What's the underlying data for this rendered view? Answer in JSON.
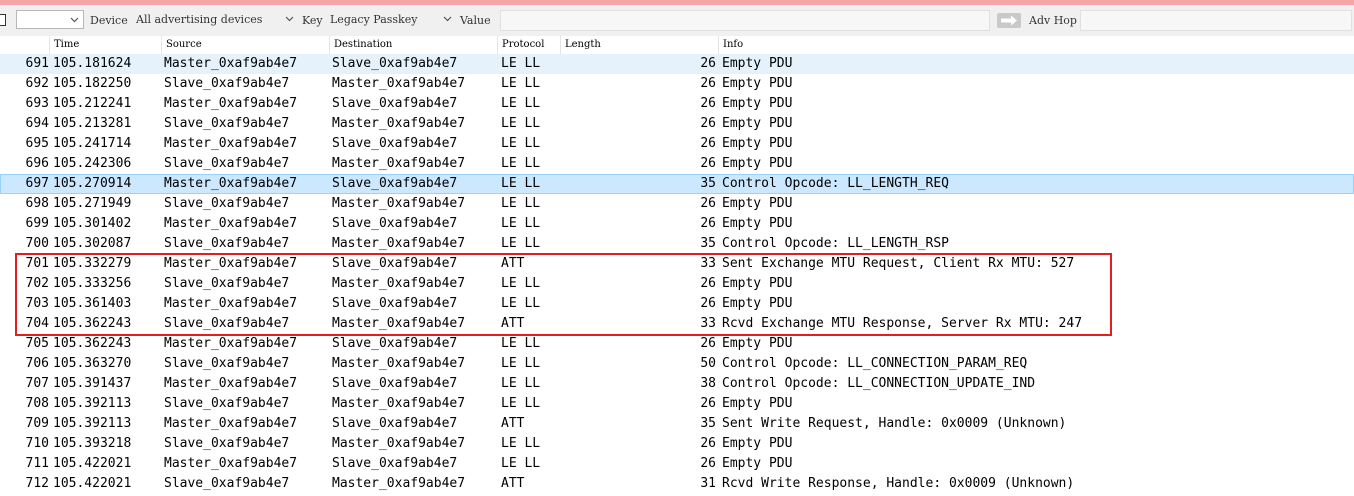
{
  "toolbar": {
    "interface_value": "",
    "device_label": "Device",
    "device_value": "All advertising devices",
    "key_label": "Key",
    "key_value": "Legacy Passkey",
    "value_label": "Value",
    "adv_hop_label": "Adv Hop"
  },
  "columns": [
    "Time",
    "Source",
    "Destination",
    "Protocol",
    "Length",
    "Info"
  ],
  "packets": [
    {
      "no": "691",
      "time": "105.181624",
      "source": "Master_0xaf9ab4e7",
      "destination": "Slave_0xaf9ab4e7",
      "protocol": "LE LL",
      "length": "26",
      "info": "Empty PDU"
    },
    {
      "no": "692",
      "time": "105.182250",
      "source": "Slave_0xaf9ab4e7",
      "destination": "Master_0xaf9ab4e7",
      "protocol": "LE LL",
      "length": "26",
      "info": "Empty PDU"
    },
    {
      "no": "693",
      "time": "105.212241",
      "source": "Master_0xaf9ab4e7",
      "destination": "Slave_0xaf9ab4e7",
      "protocol": "LE LL",
      "length": "26",
      "info": "Empty PDU"
    },
    {
      "no": "694",
      "time": "105.213281",
      "source": "Slave_0xaf9ab4e7",
      "destination": "Master_0xaf9ab4e7",
      "protocol": "LE LL",
      "length": "26",
      "info": "Empty PDU"
    },
    {
      "no": "695",
      "time": "105.241714",
      "source": "Master_0xaf9ab4e7",
      "destination": "Slave_0xaf9ab4e7",
      "protocol": "LE LL",
      "length": "26",
      "info": "Empty PDU"
    },
    {
      "no": "696",
      "time": "105.242306",
      "source": "Slave_0xaf9ab4e7",
      "destination": "Master_0xaf9ab4e7",
      "protocol": "LE LL",
      "length": "26",
      "info": "Empty PDU"
    },
    {
      "no": "697",
      "time": "105.270914",
      "source": "Master_0xaf9ab4e7",
      "destination": "Slave_0xaf9ab4e7",
      "protocol": "LE LL",
      "length": "35",
      "info": "Control Opcode: LL_LENGTH_REQ"
    },
    {
      "no": "698",
      "time": "105.271949",
      "source": "Slave_0xaf9ab4e7",
      "destination": "Master_0xaf9ab4e7",
      "protocol": "LE LL",
      "length": "26",
      "info": "Empty PDU"
    },
    {
      "no": "699",
      "time": "105.301402",
      "source": "Master_0xaf9ab4e7",
      "destination": "Slave_0xaf9ab4e7",
      "protocol": "LE LL",
      "length": "26",
      "info": "Empty PDU"
    },
    {
      "no": "700",
      "time": "105.302087",
      "source": "Slave_0xaf9ab4e7",
      "destination": "Master_0xaf9ab4e7",
      "protocol": "LE LL",
      "length": "35",
      "info": "Control Opcode: LL_LENGTH_RSP"
    },
    {
      "no": "701",
      "time": "105.332279",
      "source": "Master_0xaf9ab4e7",
      "destination": "Slave_0xaf9ab4e7",
      "protocol": "ATT",
      "length": "33",
      "info": "Sent Exchange MTU Request, Client Rx MTU: 527"
    },
    {
      "no": "702",
      "time": "105.333256",
      "source": "Slave_0xaf9ab4e7",
      "destination": "Master_0xaf9ab4e7",
      "protocol": "LE LL",
      "length": "26",
      "info": "Empty PDU"
    },
    {
      "no": "703",
      "time": "105.361403",
      "source": "Master_0xaf9ab4e7",
      "destination": "Slave_0xaf9ab4e7",
      "protocol": "LE LL",
      "length": "26",
      "info": "Empty PDU"
    },
    {
      "no": "704",
      "time": "105.362243",
      "source": "Slave_0xaf9ab4e7",
      "destination": "Master_0xaf9ab4e7",
      "protocol": "ATT",
      "length": "33",
      "info": "Rcvd Exchange MTU Response, Server Rx MTU: 247"
    },
    {
      "no": "705",
      "time": "105.362243",
      "source": "Master_0xaf9ab4e7",
      "destination": "Slave_0xaf9ab4e7",
      "protocol": "LE LL",
      "length": "26",
      "info": "Empty PDU"
    },
    {
      "no": "706",
      "time": "105.363270",
      "source": "Slave_0xaf9ab4e7",
      "destination": "Master_0xaf9ab4e7",
      "protocol": "LE LL",
      "length": "50",
      "info": "Control Opcode: LL_CONNECTION_PARAM_REQ"
    },
    {
      "no": "707",
      "time": "105.391437",
      "source": "Master_0xaf9ab4e7",
      "destination": "Slave_0xaf9ab4e7",
      "protocol": "LE LL",
      "length": "38",
      "info": "Control Opcode: LL_CONNECTION_UPDATE_IND"
    },
    {
      "no": "708",
      "time": "105.392113",
      "source": "Slave_0xaf9ab4e7",
      "destination": "Master_0xaf9ab4e7",
      "protocol": "LE LL",
      "length": "26",
      "info": "Empty PDU"
    },
    {
      "no": "709",
      "time": "105.392113",
      "source": "Master_0xaf9ab4e7",
      "destination": "Slave_0xaf9ab4e7",
      "protocol": "ATT",
      "length": "35",
      "info": "Sent Write Request, Handle: 0x0009 (Unknown)"
    },
    {
      "no": "710",
      "time": "105.393218",
      "source": "Slave_0xaf9ab4e7",
      "destination": "Master_0xaf9ab4e7",
      "protocol": "LE LL",
      "length": "26",
      "info": "Empty PDU"
    },
    {
      "no": "711",
      "time": "105.422021",
      "source": "Master_0xaf9ab4e7",
      "destination": "Slave_0xaf9ab4e7",
      "protocol": "LE LL",
      "length": "26",
      "info": "Empty PDU"
    },
    {
      "no": "712",
      "time": "105.422021",
      "source": "Slave_0xaf9ab4e7",
      "destination": "Master_0xaf9ab4e7",
      "protocol": "ATT",
      "length": "31",
      "info": "Rcvd Write Response, Handle: 0x0009 (Unknown)"
    }
  ],
  "selected_packet": "697",
  "highlighted_packets": [
    "701",
    "702",
    "703",
    "704"
  ],
  "colors": {
    "selected_row": "#cce8ff",
    "highlight_border": "#e02020"
  }
}
